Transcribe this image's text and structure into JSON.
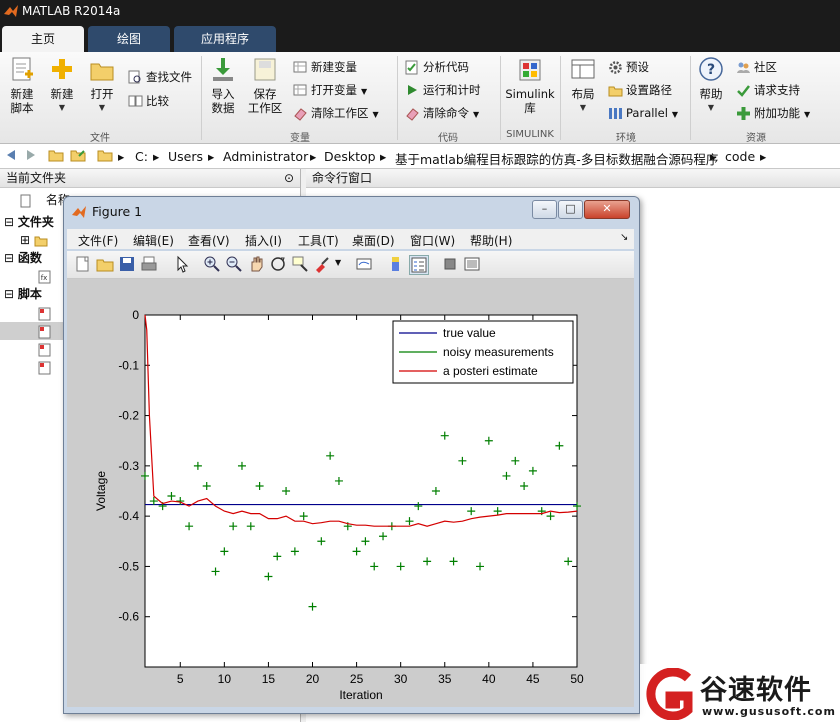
{
  "app": {
    "title": "MATLAB R2014a"
  },
  "tabs": [
    {
      "label": "主页",
      "active": true
    },
    {
      "label": "绘图",
      "active": false
    },
    {
      "label": "应用程序",
      "active": false
    }
  ],
  "ribbon": {
    "file": {
      "new_script": "新建\n脚本",
      "new": "新建",
      "open": "打开",
      "find_files": "查找文件",
      "compare": "比较",
      "group": "文件"
    },
    "variable": {
      "import": "导入\n数据",
      "save_ws": "保存\n工作区",
      "new_var": "新建变量",
      "open_var": "打开变量",
      "clear_ws": "清除工作区",
      "group": "变量"
    },
    "code": {
      "analyze": "分析代码",
      "run_time": "运行和计时",
      "clear_cmd": "清除命令",
      "group": "代码"
    },
    "simulink": {
      "label": "Simulink\n库",
      "group": "SIMULINK"
    },
    "env": {
      "layout": "布局",
      "prefs": "预设",
      "set_path": "设置路径",
      "parallel": "Parallel",
      "group": "环境"
    },
    "resources": {
      "help": "帮助",
      "community": "社区",
      "request": "请求支持",
      "addons": "附加功能",
      "group": "资源"
    }
  },
  "address": {
    "segments": [
      "C:",
      "Users",
      "Administrator",
      "Desktop",
      "基于matlab编程目标跟踪的仿真-多目标数据融合源码程序",
      "code"
    ]
  },
  "left_panel": {
    "title": "当前文件夹",
    "name_col": "名称",
    "sections": [
      "文件夹",
      "函数",
      "脚本"
    ]
  },
  "cmd_panel": {
    "title": "命令行窗口"
  },
  "figure": {
    "title": "Figure 1",
    "menu": [
      "文件(F)",
      "编辑(E)",
      "查看(V)",
      "插入(I)",
      "工具(T)",
      "桌面(D)",
      "窗口(W)",
      "帮助(H)"
    ],
    "toolbar_icons": [
      "new-figure-icon",
      "open-file-icon",
      "save-icon",
      "print-icon",
      "pointer-icon",
      "zoom-in-icon",
      "zoom-out-icon",
      "pan-icon",
      "rotate-icon",
      "data-cursor-icon",
      "brush-icon",
      "link-icon",
      "colorbar-icon",
      "legend-icon",
      "hide-tools-icon",
      "show-tools-icon"
    ]
  },
  "chart_data": {
    "type": "line",
    "title": "",
    "xlabel": "Iteration",
    "ylabel": "Voltage",
    "xlim": [
      1,
      50
    ],
    "ylim": [
      -0.7,
      0
    ],
    "xticks": [
      5,
      10,
      15,
      20,
      25,
      30,
      35,
      40,
      45,
      50
    ],
    "yticks": [
      0,
      -0.1,
      -0.2,
      -0.3,
      -0.4,
      -0.5,
      -0.6
    ],
    "legend_position": "top-right",
    "series": [
      {
        "name": "true value",
        "color": "#00008b",
        "style": "line",
        "x": [
          1,
          50
        ],
        "y": [
          -0.377,
          -0.377
        ]
      },
      {
        "name": "noisy measurements",
        "color": "#007f00",
        "style": "plus",
        "x": [
          1,
          2,
          3,
          4,
          5,
          6,
          7,
          8,
          9,
          10,
          11,
          12,
          13,
          14,
          15,
          16,
          17,
          18,
          19,
          20,
          21,
          22,
          23,
          24,
          25,
          26,
          27,
          28,
          29,
          30,
          31,
          32,
          33,
          34,
          35,
          36,
          37,
          38,
          39,
          40,
          41,
          42,
          43,
          44,
          45,
          46,
          47,
          48,
          49,
          50
        ],
        "y": [
          -0.32,
          -0.37,
          -0.38,
          -0.36,
          -0.37,
          -0.42,
          -0.3,
          -0.34,
          -0.51,
          -0.47,
          -0.42,
          -0.3,
          -0.42,
          -0.34,
          -0.52,
          -0.48,
          -0.35,
          -0.47,
          -0.4,
          -0.58,
          -0.45,
          -0.28,
          -0.33,
          -0.42,
          -0.47,
          -0.45,
          -0.5,
          -0.44,
          -0.42,
          -0.5,
          -0.41,
          -0.38,
          -0.49,
          -0.35,
          -0.24,
          -0.49,
          -0.29,
          -0.39,
          -0.5,
          -0.25,
          -0.39,
          -0.32,
          -0.29,
          -0.34,
          -0.31,
          -0.39,
          -0.4,
          -0.26,
          -0.49,
          -0.38
        ]
      },
      {
        "name": "a posteri estimate",
        "color": "#d40000",
        "style": "line",
        "x": [
          1,
          1.2,
          1.5,
          2,
          3,
          4,
          5,
          6,
          7,
          8,
          9,
          10,
          11,
          12,
          13,
          14,
          15,
          16,
          17,
          18,
          19,
          20,
          21,
          22,
          23,
          24,
          25,
          26,
          27,
          28,
          29,
          30,
          31,
          32,
          33,
          34,
          35,
          36,
          37,
          38,
          39,
          40,
          41,
          42,
          43,
          44,
          45,
          46,
          47,
          48,
          49,
          50
        ],
        "y": [
          0,
          -0.03,
          -0.2,
          -0.36,
          -0.375,
          -0.37,
          -0.372,
          -0.38,
          -0.37,
          -0.365,
          -0.38,
          -0.39,
          -0.395,
          -0.39,
          -0.395,
          -0.395,
          -0.405,
          -0.405,
          -0.4,
          -0.41,
          -0.41,
          -0.415,
          -0.413,
          -0.41,
          -0.41,
          -0.415,
          -0.418,
          -0.418,
          -0.42,
          -0.42,
          -0.42,
          -0.42,
          -0.42,
          -0.415,
          -0.42,
          -0.415,
          -0.41,
          -0.412,
          -0.41,
          -0.405,
          -0.402,
          -0.4,
          -0.398,
          -0.395,
          -0.395,
          -0.395,
          -0.395,
          -0.395,
          -0.39,
          -0.393,
          -0.392,
          -0.39
        ]
      }
    ]
  },
  "watermark": {
    "brand": "谷速软件",
    "url": "www.gususoft.com",
    "color": "#d42020"
  }
}
